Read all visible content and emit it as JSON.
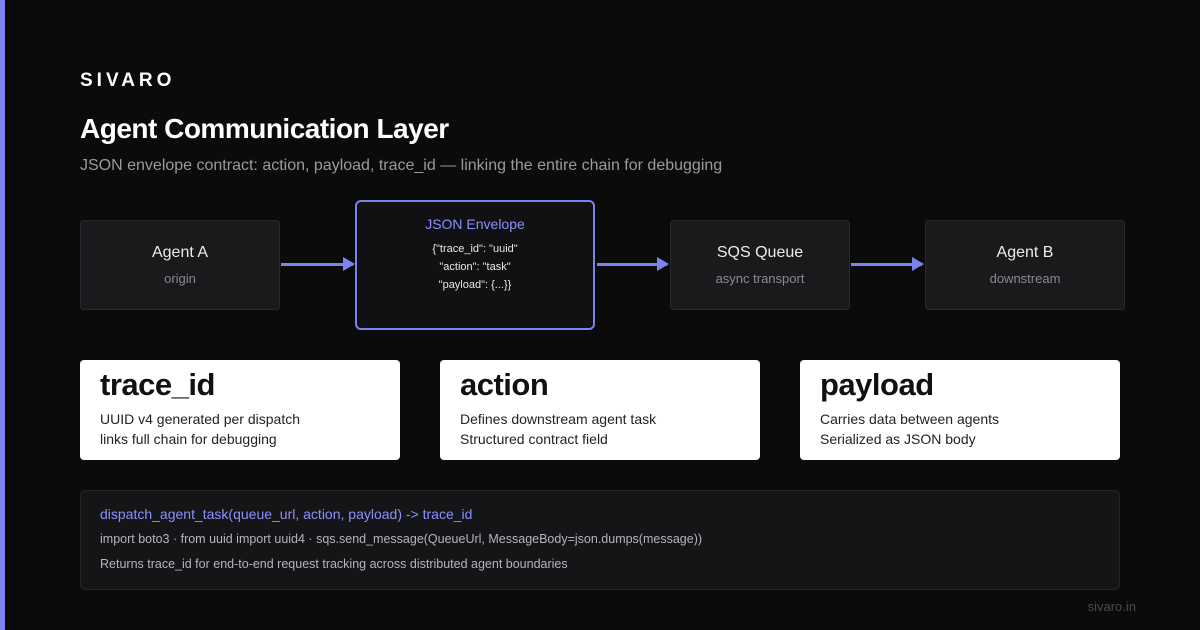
{
  "brand": "SIVARO",
  "title": "Agent Communication Layer",
  "subtitle": "JSON envelope contract: action, payload, trace_id — linking the entire chain for debugging",
  "flow": {
    "agent_a": {
      "name": "Agent A",
      "sub": "origin"
    },
    "envelope": {
      "title": "JSON Envelope",
      "lines": [
        "{\"trace_id\": \"uuid\"",
        "\"action\": \"task\"",
        "\"payload\": {...}}"
      ]
    },
    "sqs": {
      "name": "SQS Queue",
      "sub": "async transport"
    },
    "agent_b": {
      "name": "Agent B",
      "sub": "downstream"
    }
  },
  "cards": [
    {
      "title": "trace_id",
      "lines": [
        "UUID v4 generated per dispatch",
        "links full chain for debugging"
      ]
    },
    {
      "title": "action",
      "lines": [
        "Defines downstream agent task",
        "Structured contract field"
      ]
    },
    {
      "title": "payload",
      "lines": [
        "Carries data between agents",
        "Serialized as JSON body"
      ]
    }
  ],
  "code": {
    "signature": "dispatch_agent_task(queue_url, action, payload) -> trace_id",
    "imports": "import boto3 · from uuid import uuid4 · sqs.send_message(QueueUrl, MessageBody=json.dumps(message))",
    "returns": "Returns trace_id for end-to-end request tracking across distributed agent boundaries"
  },
  "footer": "sivaro.in",
  "colors": {
    "accent": "#7c83f0",
    "background": "#0b0b0c",
    "card": "#ffffff"
  }
}
